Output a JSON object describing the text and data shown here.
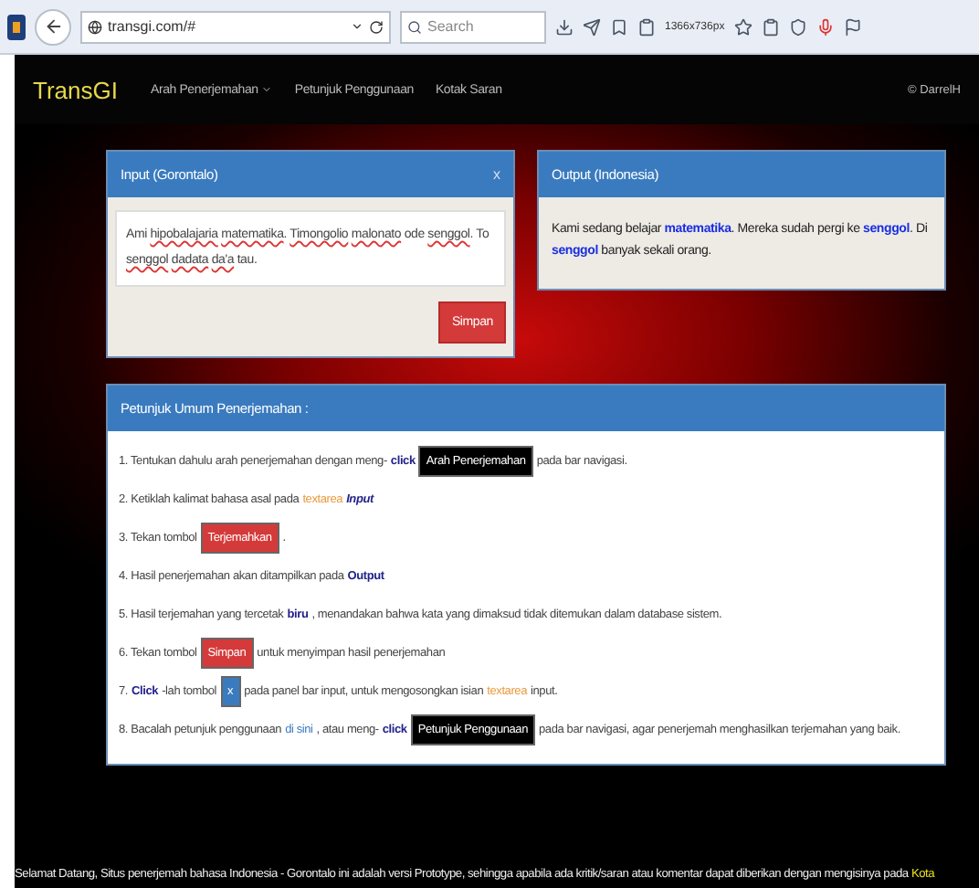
{
  "browser": {
    "url": "transgi.com/#",
    "search_placeholder": "Search",
    "viewport_size": "1366x736px"
  },
  "navbar": {
    "brand": "TransGI",
    "items": [
      {
        "label": "Arah Penerjemahan",
        "dropdown": true
      },
      {
        "label": "Petunjuk Penggunaan",
        "dropdown": false
      },
      {
        "label": "Kotak Saran",
        "dropdown": false
      }
    ],
    "credit": "© DarrelH"
  },
  "input_panel": {
    "title": "Input (Gorontalo)",
    "close": "x",
    "text": [
      {
        "t": "Ami",
        "misspelled": false
      },
      {
        "t": "hipobalajaria",
        "misspelled": true
      },
      {
        "t": "matematika",
        "misspelled": true,
        "after": "."
      },
      {
        "t": "Timongolio",
        "misspelled": true
      },
      {
        "t": "malonato",
        "misspelled": true
      },
      {
        "t": "ode",
        "misspelled": false
      },
      {
        "t": "senggol",
        "misspelled": true,
        "after": "."
      },
      {
        "t": "To",
        "misspelled": false
      },
      {
        "t": "senggol",
        "misspelled": true
      },
      {
        "t": "dadata",
        "misspelled": true
      },
      {
        "t": "da'a",
        "misspelled": true
      },
      {
        "t": "tau.",
        "misspelled": false
      }
    ],
    "save_button": "Simpan"
  },
  "output_panel": {
    "title": "Output (Indonesia)",
    "text": [
      {
        "t": "Kami sedang belajar ",
        "unknown": false
      },
      {
        "t": "matematika",
        "unknown": true
      },
      {
        "t": ". Mereka sudah pergi ke ",
        "unknown": false
      },
      {
        "t": "senggol",
        "unknown": true
      },
      {
        "t": ". Di ",
        "unknown": false
      },
      {
        "t": "senggol",
        "unknown": true
      },
      {
        "t": " banyak sekali orang.",
        "unknown": false
      }
    ]
  },
  "instructions": {
    "title": "Petunjuk Umum Penerjemahan :",
    "steps": [
      [
        {
          "kind": "text",
          "t": "1. Tentukan dahulu arah penerjemahan dengan meng-"
        },
        {
          "kind": "keyword",
          "t": "click"
        },
        {
          "kind": "black-label",
          "t": "Arah Penerjemahan"
        },
        {
          "kind": "text",
          "t": "pada bar navigasi."
        }
      ],
      [
        {
          "kind": "text",
          "t": "2. Ketiklah kalimat bahasa asal pada"
        },
        {
          "kind": "orange",
          "t": "textarea"
        },
        {
          "kind": "keyword-italic",
          "t": "Input"
        }
      ],
      [
        {
          "kind": "text",
          "t": "3. Tekan tombol"
        },
        {
          "kind": "red-label",
          "t": "Terjemahkan"
        },
        {
          "kind": "text",
          "t": "."
        }
      ],
      [
        {
          "kind": "text",
          "t": "4. Hasil penerjemahan akan ditampilkan pada"
        },
        {
          "kind": "keyword",
          "t": "Output"
        }
      ],
      [
        {
          "kind": "text",
          "t": "5. Hasil terjemahan yang tercetak"
        },
        {
          "kind": "keyword",
          "t": "biru"
        },
        {
          "kind": "text",
          "t": ", menandakan bahwa kata yang dimaksud tidak ditemukan dalam database sistem."
        }
      ],
      [
        {
          "kind": "text",
          "t": "6. Tekan tombol"
        },
        {
          "kind": "red-label",
          "t": "Simpan"
        },
        {
          "kind": "text",
          "t": "untuk menyimpan hasil penerjemahan"
        }
      ],
      [
        {
          "kind": "text",
          "t": "7."
        },
        {
          "kind": "keyword",
          "t": "Click"
        },
        {
          "kind": "text",
          "t": "-lah tombol"
        },
        {
          "kind": "blue-label",
          "t": "x"
        },
        {
          "kind": "text",
          "t": "pada panel bar input, untuk mengosongkan isian"
        },
        {
          "kind": "orange",
          "t": "textarea"
        },
        {
          "kind": "text",
          "t": "input."
        }
      ],
      [
        {
          "kind": "text",
          "t": "8. Bacalah petunjuk penggunaan"
        },
        {
          "kind": "link",
          "t": "di sini"
        },
        {
          "kind": "text",
          "t": ", atau meng-"
        },
        {
          "kind": "keyword",
          "t": "click"
        },
        {
          "kind": "black-label",
          "t": "Petunjuk Penggunaan"
        },
        {
          "kind": "text",
          "t": "pada bar navigasi, agar penerjemah menghasilkan terjemahan yang baik."
        }
      ]
    ]
  },
  "footer": {
    "text": "Selamat Datang, Situs penerjemah bahasa Indonesia - Gorontalo ini adalah versi Prototype, sehingga apabila ada kritik/saran atau komentar dapat diberikan dengan mengisinya pada",
    "link": "Kota"
  }
}
